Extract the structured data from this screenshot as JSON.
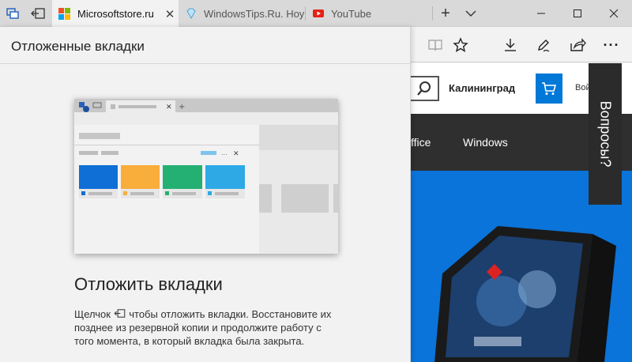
{
  "browser": {
    "tabs": [
      {
        "label": "Microsoftstore.ru",
        "favicon": "microsoft-logo-icon",
        "active": true
      },
      {
        "label": "WindowsTips.Ru. Ноу",
        "favicon": "gem-icon",
        "active": false
      },
      {
        "label": "YouTube",
        "favicon": "youtube-icon",
        "active": false
      }
    ],
    "new_tab_symbol": "+",
    "tab_list_symbol": "⌄",
    "window_controls": {
      "minimize": "–",
      "maximize": "☐",
      "close": "✕"
    },
    "toolbar_icons": [
      "reading-view-icon",
      "favorite-star-icon",
      "downloads-icon",
      "notes-pen-icon",
      "share-icon",
      "more-icon"
    ],
    "more_label": "···"
  },
  "panel": {
    "title": "Отложенные вкладки",
    "heading": "Отложить вкладки",
    "description_before": "Щелчок",
    "description_after": "чтобы отложить вкладки. Восстановите их позднее из резервной копии и продолжите работу с того момента, в который вкладка была закрыта."
  },
  "page": {
    "city": "Калининград",
    "signin": "Вой",
    "nav_items": [
      "ffice",
      "Windows"
    ],
    "questions_label": "Вопросы?"
  },
  "colors": {
    "accent": "#0078d7",
    "illus_tiles": [
      "#0f6fd6",
      "#f9ad3b",
      "#23b072",
      "#2ea9e6"
    ]
  }
}
